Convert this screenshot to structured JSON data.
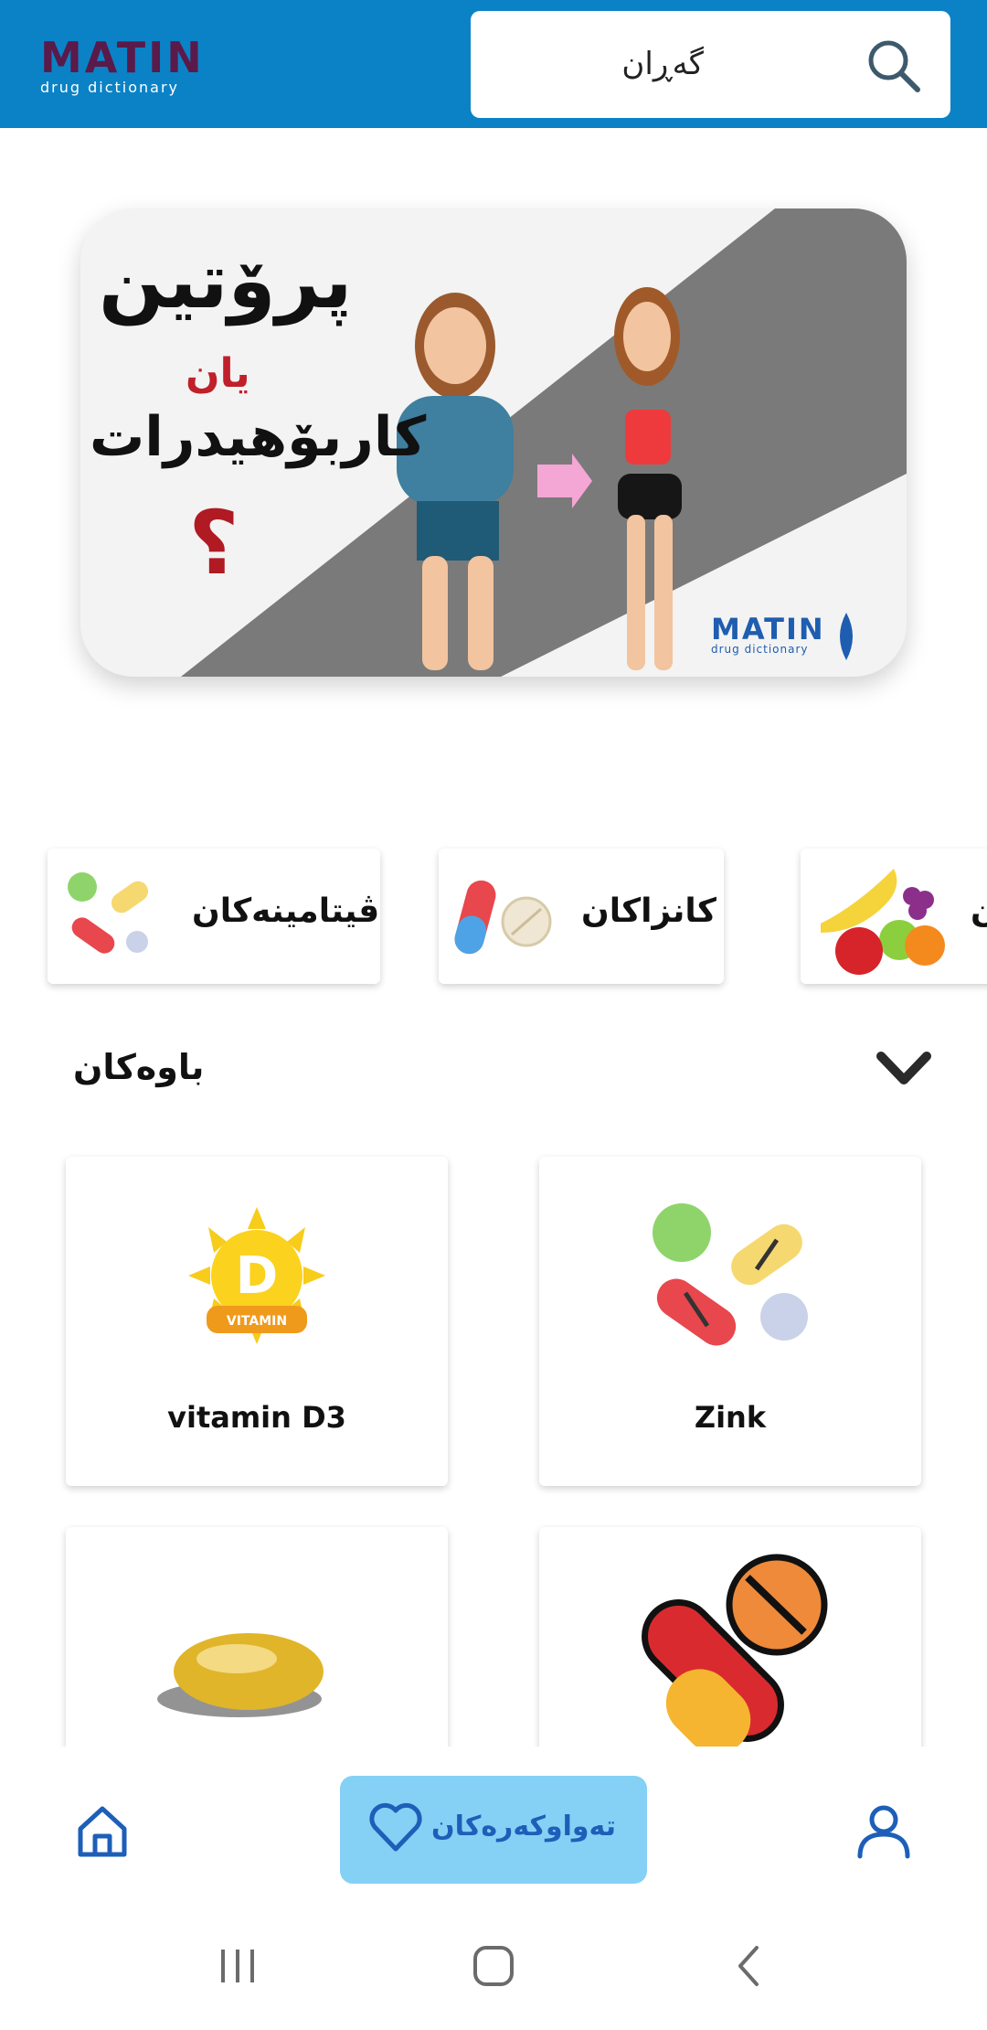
{
  "header": {
    "logo_word": "MATIN",
    "logo_sub": "drug dictionary",
    "search_label": "گەڕان"
  },
  "banner": {
    "title": "پرۆتین",
    "or": "یان",
    "subject": "کاربۆهیدرات",
    "question": "؟",
    "logo_word": "MATIN",
    "logo_sub": "drug dictionary"
  },
  "categories": [
    {
      "label": "ڤیتامینەکان",
      "icon": "multi-pill-icon"
    },
    {
      "label": "کانزاکان",
      "icon": "capsule-tablet-icon"
    },
    {
      "label": "ن",
      "icon": "fruits-icon"
    }
  ],
  "section": {
    "title": "باوەکان"
  },
  "items": [
    {
      "label": "Zink",
      "icon": "multi-pill-icon"
    },
    {
      "label": "vitamin D3",
      "icon": "vitamin-d-sun-icon",
      "badge": "D",
      "badge_sub": "VITAMIN"
    },
    {
      "label": "",
      "icon": "red-yellow-pill-icon"
    },
    {
      "label": "",
      "icon": "softgel-capsule-icon"
    }
  ],
  "bottom_nav": {
    "favorites_label": "تەواوکەرەکان"
  },
  "colors": {
    "header_bg": "#0b82c6",
    "fav_bg": "#84d1f5",
    "nav_icon": "#1d5fb8"
  }
}
